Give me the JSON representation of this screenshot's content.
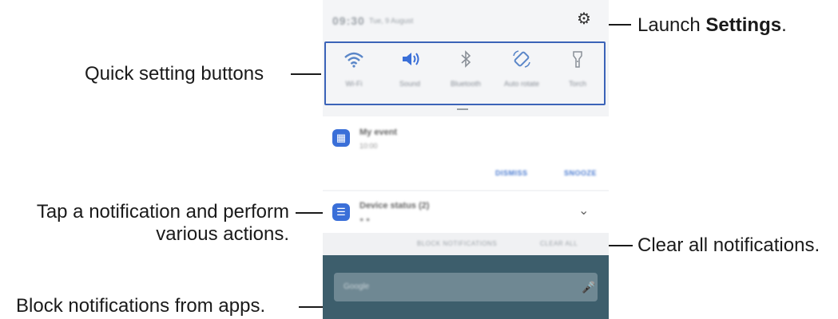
{
  "callouts": {
    "settings_pre": "Launch ",
    "settings_bold": "Settings",
    "settings_post": ".",
    "quick": "Quick setting buttons",
    "tap_line1": "Tap a notification and perform",
    "tap_line2": "various actions.",
    "clear": "Clear all notifications.",
    "block": "Block notifications from apps."
  },
  "status": {
    "time": "09:30",
    "date": "Tue, 9 August"
  },
  "quick_settings": [
    {
      "icon": "wifi-icon",
      "label": "Wi-Fi"
    },
    {
      "icon": "sound-icon",
      "label": "Sound"
    },
    {
      "icon": "bluetooth-icon",
      "label": "Bluetooth"
    },
    {
      "icon": "auto-rotate-icon",
      "label": "Auto rotate"
    },
    {
      "icon": "torch-icon",
      "label": "Torch"
    }
  ],
  "notifications": [
    {
      "icon": "calendar-icon",
      "title": "My event",
      "subtitle": "10:00",
      "actions": [
        "DISMISS",
        "SNOOZE"
      ]
    },
    {
      "icon": "list-icon",
      "title": "Device status (2)",
      "subtitle": ""
    }
  ],
  "footer": {
    "block": "BLOCK NOTIFICATIONS",
    "clear": "CLEAR ALL"
  },
  "search": {
    "placeholder": "Google"
  },
  "colors": {
    "highlight": "#3b63b8",
    "accent": "#3a6fd8",
    "wallpaper": "#3d5e6c"
  }
}
